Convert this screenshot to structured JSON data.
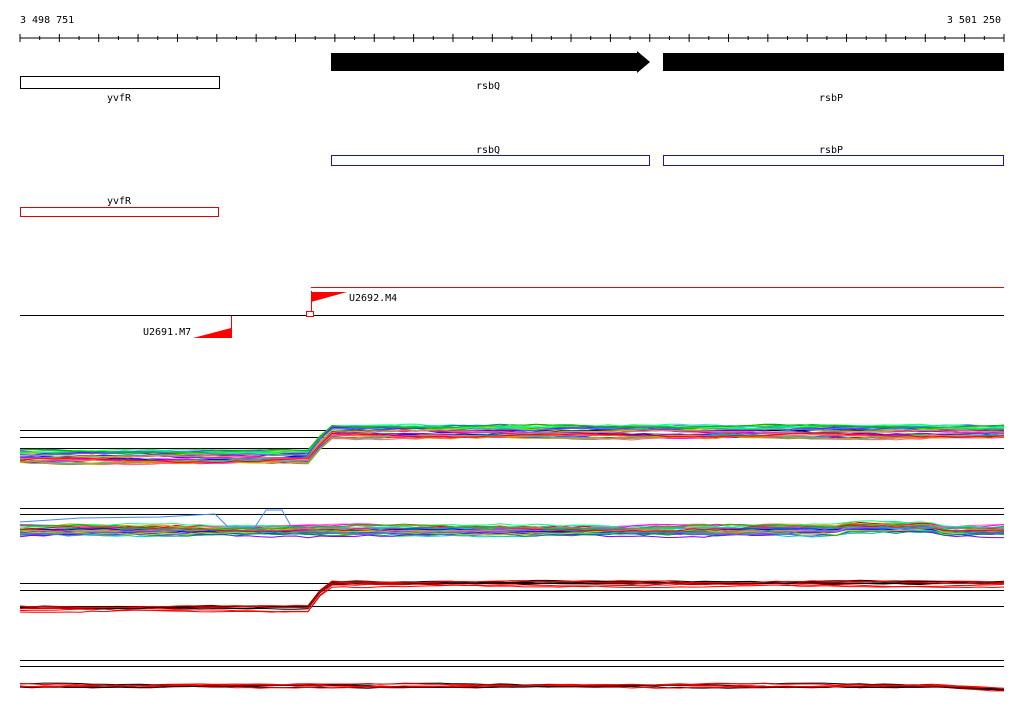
{
  "coords": {
    "start": "3 498 751",
    "end": "3 501 250"
  },
  "genes_strand": [
    {
      "name": "yvfR",
      "style": "outline"
    },
    {
      "name": "rsbQ",
      "style": "arrow"
    },
    {
      "name": "rsbP",
      "style": "block"
    }
  ],
  "genes_blue": [
    {
      "name": "rsbQ"
    },
    {
      "name": "rsbP"
    }
  ],
  "genes_red": [
    {
      "name": "yvfR"
    }
  ],
  "tus": [
    {
      "name": "U2692.M4",
      "strand": "+"
    },
    {
      "name": "U2691.M7",
      "strand": "-"
    }
  ],
  "colors": {
    "gene_fill": "#000000",
    "gene_outline_blue": "#1a1aa0",
    "gene_outline_red": "#e00000",
    "tu_marker": "#ff0000",
    "axis": "#000000"
  },
  "expression_palette": [
    "#ff0000",
    "#00c000",
    "#0000ff",
    "#ff00ff",
    "#00c8c8",
    "#c8a000",
    "#808080",
    "#8000ff",
    "#ff8000",
    "#008080",
    "#a0e000",
    "#ff60a0",
    "#6060ff",
    "#00ff80"
  ]
}
